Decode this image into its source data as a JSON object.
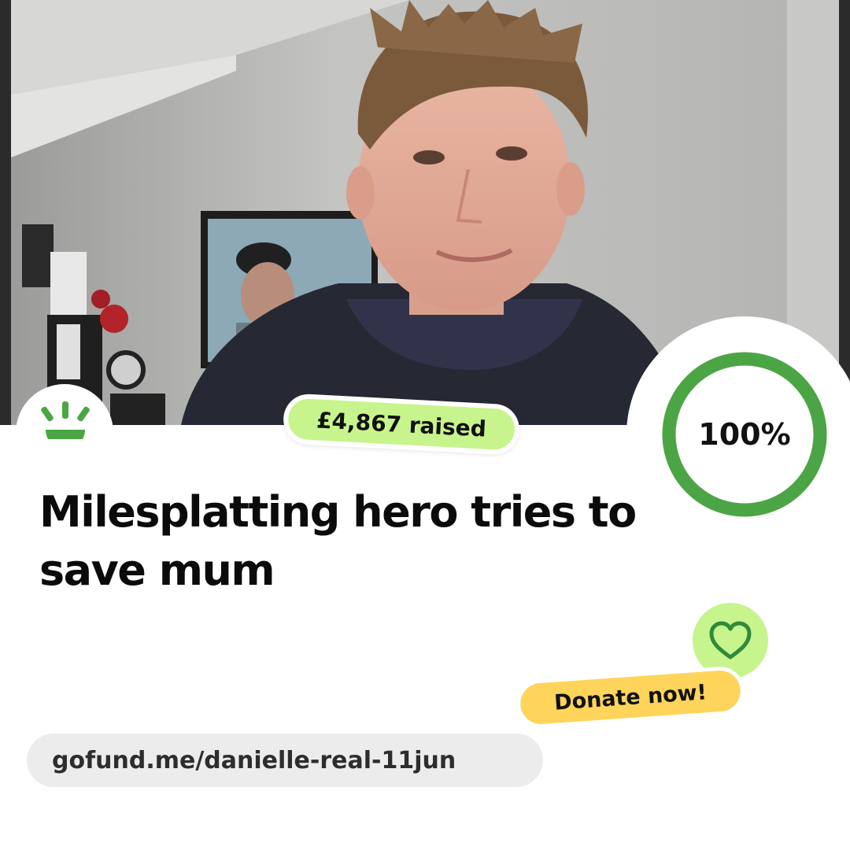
{
  "photo": {
    "description_icon": "photo-icon"
  },
  "brand": {
    "logo_icon": "gofundme-sun-logo",
    "accent_color": "#4ca544"
  },
  "fundraiser": {
    "raised_label": "£4,867 raised",
    "progress_percent": 100,
    "progress_label": "100%",
    "title": "Milesplatting hero tries to save mum",
    "cta_label": "Donate now!",
    "heart_icon": "heart-icon",
    "url": "gofund.me/danielle-real-11jun"
  },
  "colors": {
    "raised_pill": "#c7f48c",
    "donate_pill": "#ffd45a",
    "progress_ring": "#4ca544",
    "url_pill": "#ececec"
  }
}
